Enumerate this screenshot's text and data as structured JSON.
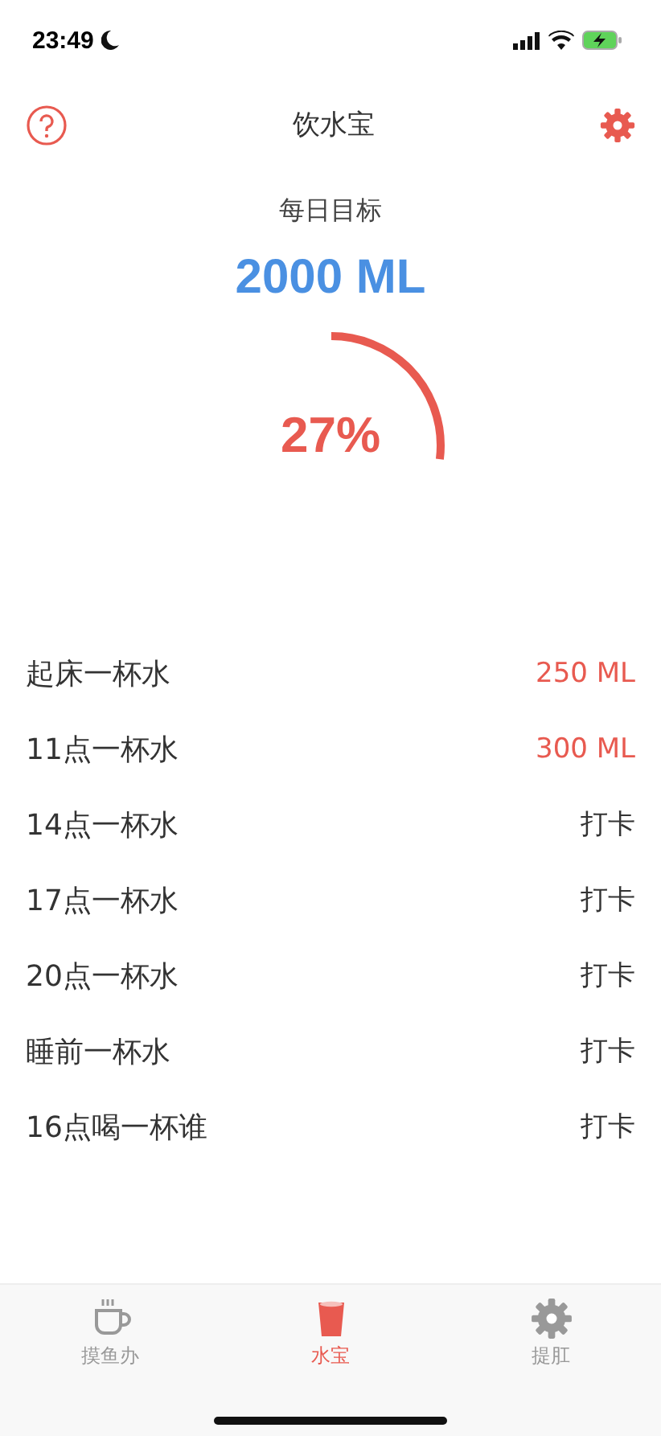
{
  "status_bar": {
    "time": "23:49"
  },
  "nav": {
    "title": "饮水宝"
  },
  "goal": {
    "label": "每日目标",
    "amount": "2000 ML",
    "level": 0.27,
    "percent": "27%"
  },
  "entries": [
    {
      "name": "起床一杯水",
      "value": "250 ML",
      "done": true
    },
    {
      "name": "11点一杯水",
      "value": "300 ML",
      "done": true
    },
    {
      "name": "14点一杯水",
      "value": "打卡",
      "done": false
    },
    {
      "name": "17点一杯水",
      "value": "打卡",
      "done": false
    },
    {
      "name": "20点一杯水",
      "value": "打卡",
      "done": false
    },
    {
      "name": "睡前一杯水",
      "value": "打卡",
      "done": false
    },
    {
      "name": "16点喝一杯谁",
      "value": "打卡",
      "done": false
    }
  ],
  "tabs": [
    {
      "label": "摸鱼办",
      "kind": "cup",
      "selected": false
    },
    {
      "label": "水宝",
      "kind": "glass",
      "selected": true
    },
    {
      "label": "提肛",
      "kind": "gear",
      "selected": false
    }
  ]
}
